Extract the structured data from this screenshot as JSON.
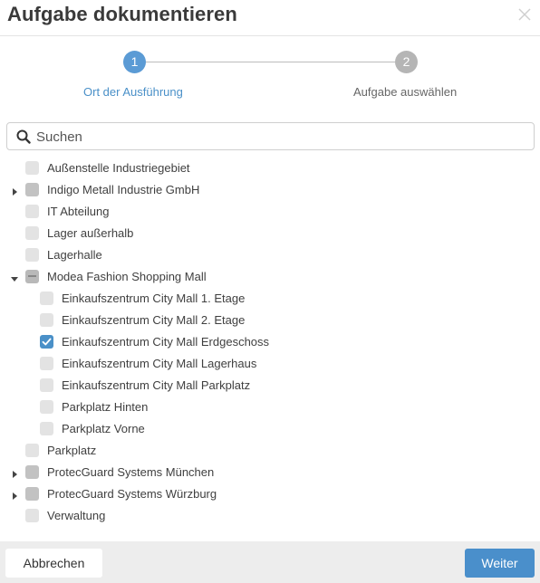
{
  "dialog": {
    "title": "Aufgabe dokumentieren"
  },
  "stepper": {
    "steps": [
      {
        "number": "1",
        "label": "Ort der Ausführung",
        "state": "active"
      },
      {
        "number": "2",
        "label": "Aufgabe auswählen",
        "state": "inactive"
      }
    ]
  },
  "search": {
    "placeholder": "Suchen",
    "value": ""
  },
  "tree": {
    "items": [
      {
        "label": "Außenstelle Industriegebiet",
        "level": 0,
        "expander": "none",
        "check": "unchecked"
      },
      {
        "label": "Indigo Metall Industrie GmbH",
        "level": 0,
        "expander": "collapsed",
        "check": "unchecked-dark"
      },
      {
        "label": "IT Abteilung",
        "level": 0,
        "expander": "none",
        "check": "unchecked"
      },
      {
        "label": "Lager außerhalb",
        "level": 0,
        "expander": "none",
        "check": "unchecked"
      },
      {
        "label": "Lagerhalle",
        "level": 0,
        "expander": "none",
        "check": "unchecked"
      },
      {
        "label": "Modea Fashion Shopping Mall",
        "level": 0,
        "expander": "expanded",
        "check": "partial"
      },
      {
        "label": "Einkaufszentrum City Mall 1. Etage",
        "level": 1,
        "expander": "none",
        "check": "unchecked"
      },
      {
        "label": "Einkaufszentrum City Mall 2. Etage",
        "level": 1,
        "expander": "none",
        "check": "unchecked"
      },
      {
        "label": "Einkaufszentrum City Mall Erdgeschoss",
        "level": 1,
        "expander": "none",
        "check": "checked"
      },
      {
        "label": "Einkaufszentrum City Mall Lagerhaus",
        "level": 1,
        "expander": "none",
        "check": "unchecked"
      },
      {
        "label": "Einkaufszentrum City Mall Parkplatz",
        "level": 1,
        "expander": "none",
        "check": "unchecked"
      },
      {
        "label": "Parkplatz Hinten",
        "level": 1,
        "expander": "none",
        "check": "unchecked"
      },
      {
        "label": "Parkplatz Vorne",
        "level": 1,
        "expander": "none",
        "check": "unchecked"
      },
      {
        "label": "Parkplatz",
        "level": 0,
        "expander": "none",
        "check": "unchecked"
      },
      {
        "label": "ProtecGuard Systems München",
        "level": 0,
        "expander": "collapsed",
        "check": "unchecked-dark"
      },
      {
        "label": "ProtecGuard Systems Würzburg",
        "level": 0,
        "expander": "collapsed",
        "check": "unchecked-dark"
      },
      {
        "label": "Verwaltung",
        "level": 0,
        "expander": "none",
        "check": "unchecked"
      }
    ]
  },
  "footer": {
    "cancel_label": "Abbrechen",
    "next_label": "Weiter"
  },
  "colors": {
    "accent": "#4a90c8",
    "step_inactive": "#b5b5b5",
    "footer_bg": "#ededed"
  }
}
